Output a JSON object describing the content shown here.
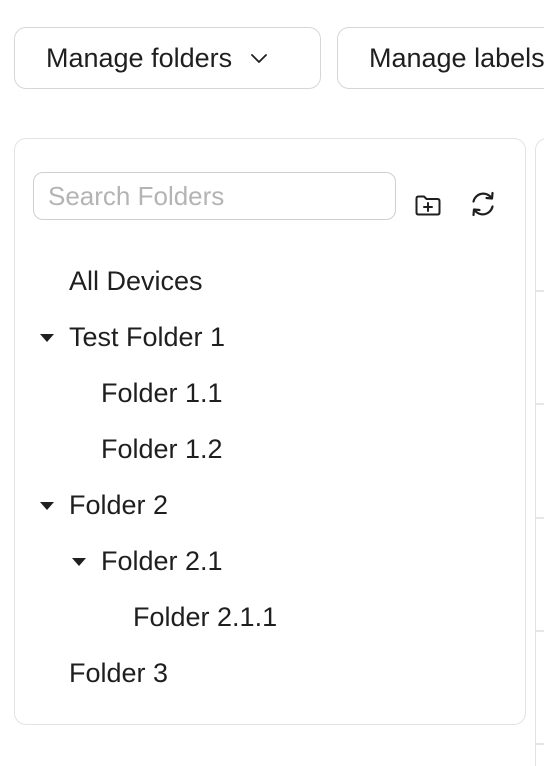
{
  "toolbar": {
    "manage_folders_label": "Manage folders",
    "manage_labels_label": "Manage labels"
  },
  "sidebar": {
    "search": {
      "placeholder": "Search Folders",
      "value": ""
    },
    "icons": {
      "new_folder": "folder-plus-icon",
      "refresh": "refresh-icon"
    },
    "tree": [
      {
        "label": "All Devices",
        "depth": 0,
        "expandable": false
      },
      {
        "label": "Test Folder 1",
        "depth": 0,
        "expandable": true,
        "expanded": true
      },
      {
        "label": "Folder 1.1",
        "depth": 1,
        "expandable": false
      },
      {
        "label": "Folder 1.2",
        "depth": 1,
        "expandable": false
      },
      {
        "label": "Folder 2",
        "depth": 0,
        "expandable": true,
        "expanded": true
      },
      {
        "label": "Folder 2.1",
        "depth": 1,
        "expandable": true,
        "expanded": true
      },
      {
        "label": "Folder 2.1.1",
        "depth": 2,
        "expandable": false
      },
      {
        "label": "Folder 3",
        "depth": 0,
        "expandable": false
      }
    ]
  }
}
